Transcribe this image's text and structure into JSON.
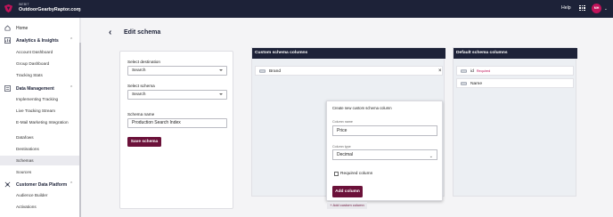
{
  "topbar": {
    "org_small": "WEBIT",
    "org_name": "OutdoorGearbyRaptor.com",
    "help": "Help",
    "avatar_initials": "MH"
  },
  "sidebar": {
    "home": "Home",
    "analytics": {
      "title": "Analytics & Insights",
      "items": [
        "Account Dashboard",
        "Group Dashboard",
        "Tracking Stats"
      ]
    },
    "data_management": {
      "title": "Data Management",
      "items": [
        "Implementing Tracking",
        "Live Tracking Stream",
        "E-Mail Marketing Integration",
        "Datafows",
        "Destinations",
        "Schemas",
        "Sources"
      ]
    },
    "cdp": {
      "title": "Customer Data Platform",
      "items": [
        "Audience Builder",
        "Activations"
      ]
    },
    "active_item": "Schemas"
  },
  "header": {
    "title": "Edit schema"
  },
  "form": {
    "destination_label": "Select destination",
    "destination_value": "Search",
    "schema_label": "Select schema",
    "schema_value": "Search",
    "name_label": "Schema name",
    "name_value": "Production Search Index",
    "save_label": "Save schema"
  },
  "custom_panel": {
    "title": "Custom schema columns",
    "fields": [
      {
        "name": "Brand"
      }
    ],
    "add_link": "+ Add custom column"
  },
  "popup": {
    "title": "Create new custom schema column",
    "column_name_label": "Column name",
    "column_name_value": "Price",
    "column_type_label": "Column type",
    "column_type_value": "Decimal",
    "required_label": "Required column",
    "required_checked": false,
    "add_label": "Add column"
  },
  "default_panel": {
    "title": "Default schema columns",
    "fields": [
      {
        "name": "id",
        "badge": "Required"
      },
      {
        "name": "Name",
        "badge": ""
      }
    ]
  },
  "colors": {
    "nav_dark": "#1d2238",
    "accent": "#6b1139",
    "avatar": "#c0135a"
  }
}
